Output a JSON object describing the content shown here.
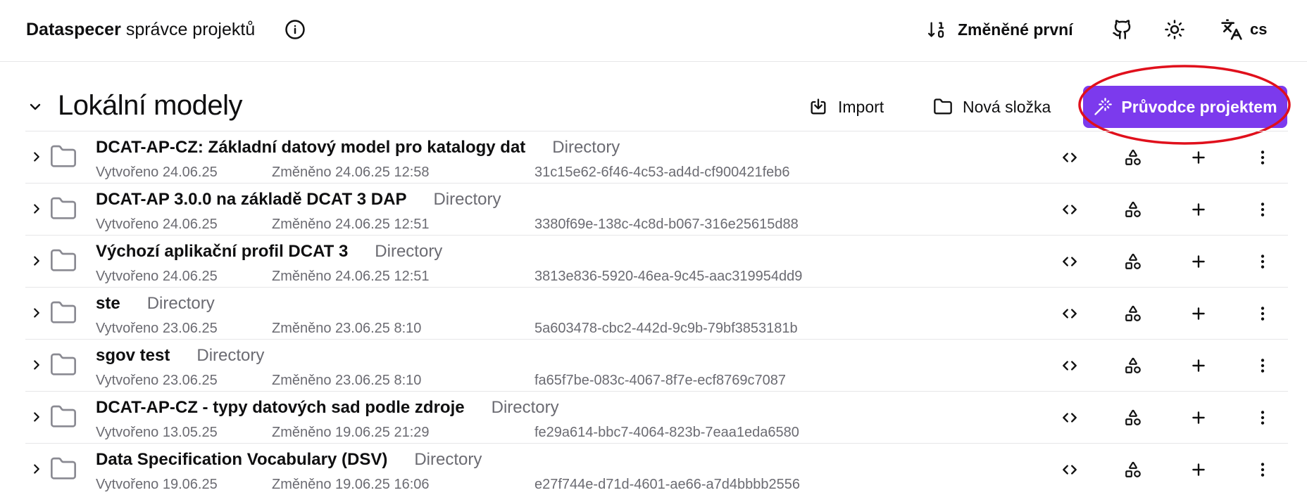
{
  "header": {
    "brand_name": "Dataspecer",
    "brand_subtitle": "správce projektů",
    "info_icon": "info-icon",
    "sort_label": "Změněné první",
    "sort_icon": "sort-descending-icon",
    "github_icon": "github-icon",
    "theme_icon": "sun-icon",
    "language_icon": "translate-icon",
    "language_code": "cs"
  },
  "section": {
    "title": "Lokální modely",
    "collapse_icon": "chevron-down-icon",
    "import_label": "Import",
    "import_icon": "import-icon",
    "new_folder_label": "Nová složka",
    "new_folder_icon": "folder-icon",
    "wizard_label": "Průvodce projektem",
    "wizard_icon": "magic-wand-icon",
    "wizard_color": "#7c3aed",
    "highlight_color": "#e0101c"
  },
  "rows": [
    {
      "name": "DCAT-AP-CZ: Základní datový model pro katalogy dat",
      "type": "Directory",
      "created": "Vytvořeno 24.06.25",
      "changed": "Změněno 24.06.25 12:58",
      "id": "31c15e62-6f46-4c53-ad4d-cf900421feb6"
    },
    {
      "name": "DCAT-AP 3.0.0 na základě DCAT 3 DAP",
      "type": "Directory",
      "created": "Vytvořeno 24.06.25",
      "changed": "Změněno 24.06.25 12:51",
      "id": "3380f69e-138c-4c8d-b067-316e25615d88"
    },
    {
      "name": "Výchozí aplikační profil DCAT 3",
      "type": "Directory",
      "created": "Vytvořeno 24.06.25",
      "changed": "Změněno 24.06.25 12:51",
      "id": "3813e836-5920-46ea-9c45-aac319954dd9"
    },
    {
      "name": "ste",
      "type": "Directory",
      "created": "Vytvořeno 23.06.25",
      "changed": "Změněno 23.06.25 8:10",
      "id": "5a603478-cbc2-442d-9c9b-79bf3853181b"
    },
    {
      "name": "sgov test",
      "type": "Directory",
      "created": "Vytvořeno 23.06.25",
      "changed": "Změněno 23.06.25 8:10",
      "id": "fa65f7be-083c-4067-8f7e-ecf8769c7087"
    },
    {
      "name": "DCAT-AP-CZ - typy datových sad podle zdroje",
      "type": "Directory",
      "created": "Vytvořeno 13.05.25",
      "changed": "Změněno 19.06.25 21:29",
      "id": "fe29a614-bbc7-4064-823b-7eaa1eda6580"
    },
    {
      "name": "Data Specification Vocabulary (DSV)",
      "type": "Directory",
      "created": "Vytvořeno 19.06.25",
      "changed": "Změněno 19.06.25 16:06",
      "id": "e27f744e-d71d-4601-ae66-a7d4bbbb2556"
    }
  ],
  "row_icons": {
    "expand": "chevron-right-icon",
    "folder": "folder-icon",
    "code": "code-icon",
    "shapes": "shapes-icon",
    "add": "plus-icon",
    "more": "more-vertical-icon"
  }
}
